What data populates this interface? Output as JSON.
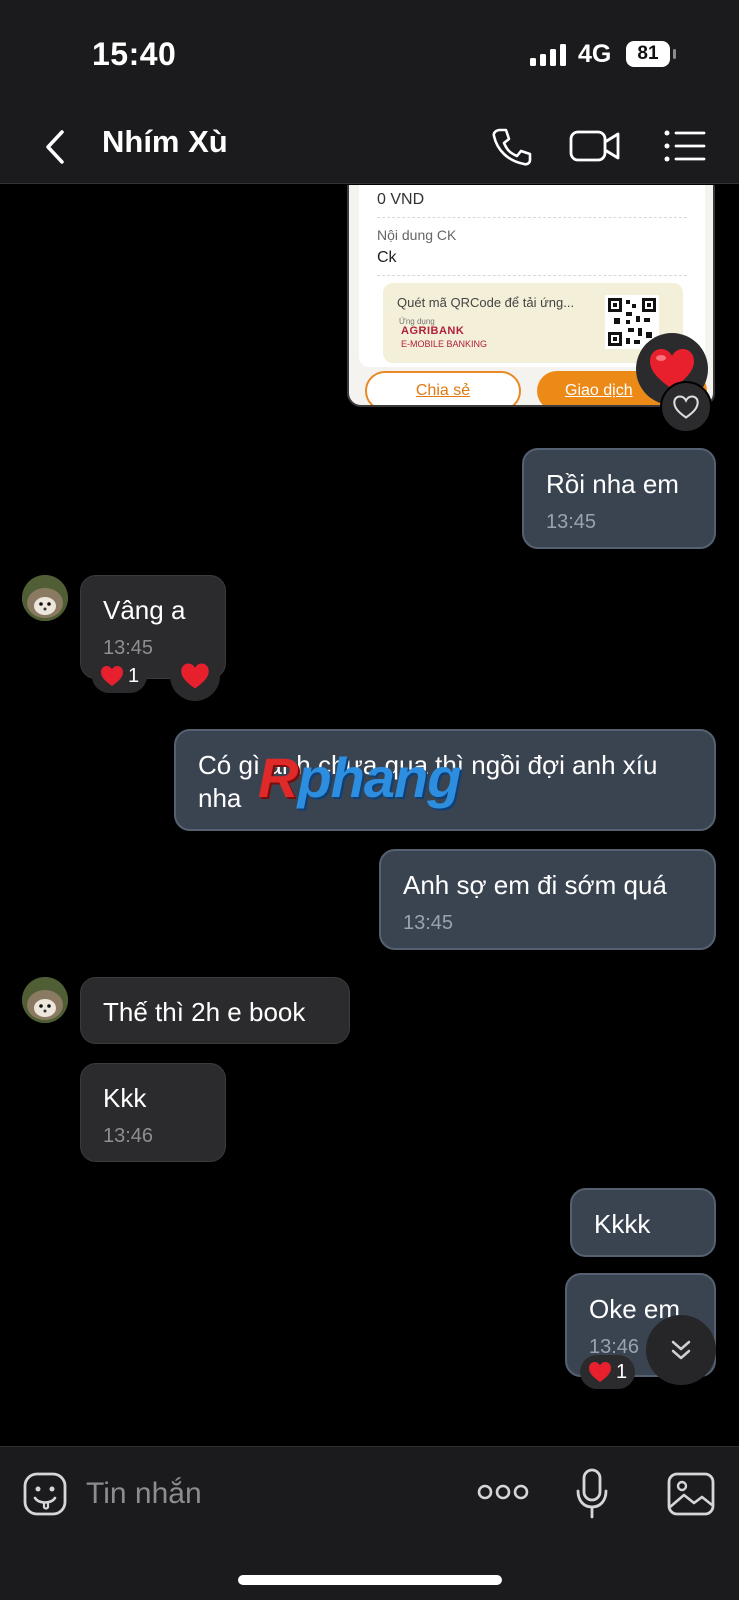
{
  "status_bar": {
    "time": "15:40",
    "network": "4G",
    "battery": "81"
  },
  "header": {
    "contact_name": "Nhím Xù"
  },
  "receipt": {
    "amount": "0 VND",
    "content_label": "Nội dung CK",
    "content_value": "Ck",
    "qr_text": "Quét mã QRCode để tải ứng...",
    "app_small": "Ứng dụng",
    "bank_name": "AGRIBANK",
    "bank_app": "E-MOBILE BANKING",
    "share_label": "Chia sẻ",
    "transaction_label": "Giao dịch"
  },
  "messages": [
    {
      "id": "m1",
      "direction": "out",
      "text": "Rồi nha em",
      "time": "13:45"
    },
    {
      "id": "m2",
      "direction": "in",
      "text": "Vâng a",
      "time": "13:45",
      "reaction_count": "1"
    },
    {
      "id": "m3",
      "direction": "out",
      "text": "Có gì anh chưa qua thì ngồi đợi anh xíu nha"
    },
    {
      "id": "m4",
      "direction": "out",
      "text": "Anh sợ em đi sớm quá",
      "time": "13:45"
    },
    {
      "id": "m5",
      "direction": "in",
      "text": "Thế thì 2h e book"
    },
    {
      "id": "m6",
      "direction": "in",
      "text": "Kkk",
      "time": "13:46"
    },
    {
      "id": "m7",
      "direction": "out",
      "text": "Kkkk"
    },
    {
      "id": "m8",
      "direction": "out",
      "text": "Oke em",
      "time": "13:46",
      "reaction_count": "1"
    }
  ],
  "watermark": {
    "first": "R",
    "rest": "phang"
  },
  "composer": {
    "placeholder": "Tin nhắn"
  },
  "colors": {
    "outgoing_bubble": "#3a4451",
    "incoming_bubble": "#2b2b2d",
    "heart": "#e8202e",
    "accent_orange": "#ec8a17"
  }
}
